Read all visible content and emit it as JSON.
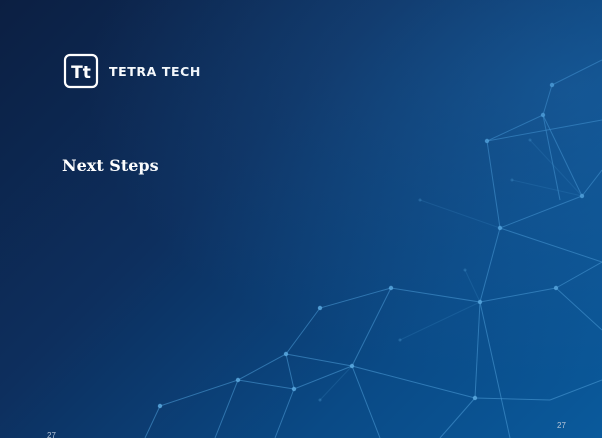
{
  "slide": {
    "brand_name": "TETRA TECH",
    "logo_mark": "Tt",
    "title": "Next Steps",
    "page_number": "27",
    "background_colors": [
      "#0c1f42",
      "#0d2f5e",
      "#0a4a86",
      "#0a5a9c"
    ],
    "network_color": "#4f9fd9"
  }
}
